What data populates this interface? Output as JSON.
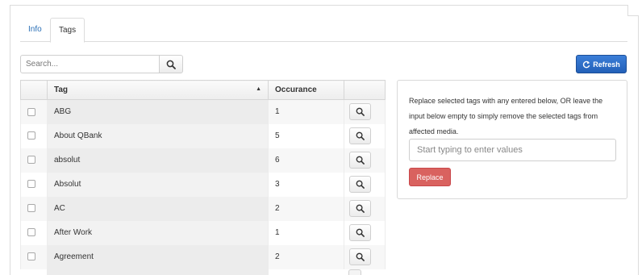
{
  "tabs": [
    {
      "label": "Info"
    },
    {
      "label": "Tags"
    }
  ],
  "search": {
    "placeholder": "Search...",
    "value": ""
  },
  "toolbar": {
    "refresh_label": "Refresh"
  },
  "table": {
    "columns": {
      "tag": "Tag",
      "occurance": "Occurance"
    },
    "sort": "ascending",
    "rows": [
      {
        "tag": "ABG",
        "occurance": "1"
      },
      {
        "tag": "About QBank",
        "occurance": "5"
      },
      {
        "tag": "absolut",
        "occurance": "6"
      },
      {
        "tag": "Absolut",
        "occurance": "3"
      },
      {
        "tag": "AC",
        "occurance": "2"
      },
      {
        "tag": "After Work",
        "occurance": "1"
      },
      {
        "tag": "Agreement",
        "occurance": "2"
      }
    ]
  },
  "panel": {
    "description": "Replace selected tags with any entered below, OR leave the input below empty to simply remove the selected tags from affected media.",
    "input_placeholder": "Start typing to enter values",
    "input_value": "",
    "replace_label": "Replace"
  },
  "colors": {
    "primary": "#2a6fb6",
    "danger": "#d9625f",
    "border": "#dcdcdc"
  },
  "icons": {
    "search": "magnifier-icon",
    "refresh": "refresh-icon",
    "sort": "sort-ascending-icon"
  }
}
